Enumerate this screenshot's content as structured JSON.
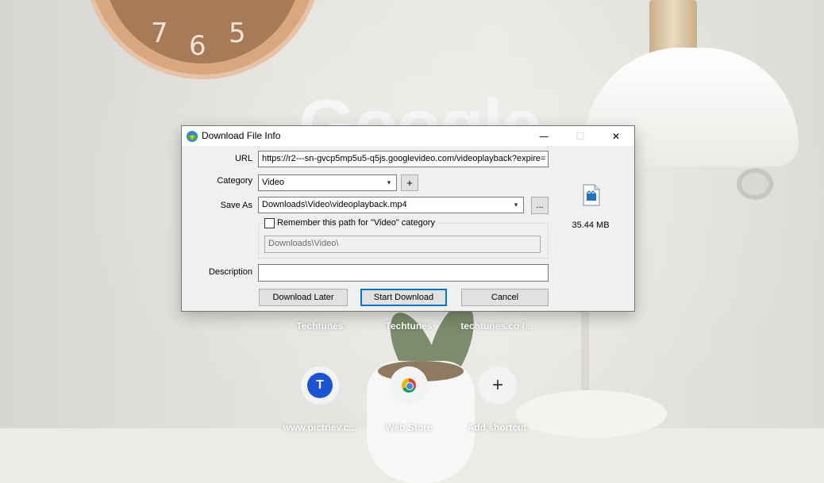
{
  "background": {
    "google_logo_text": "Google",
    "clock_numbers": [
      "7",
      "6",
      "5"
    ]
  },
  "shortcuts_row1": [
    {
      "label": "Techtunes"
    },
    {
      "label": "Techtunes"
    },
    {
      "label": "techtunes.co (..."
    }
  ],
  "shortcuts_row2": [
    {
      "label": "www.pictriev.c...",
      "avatar_letter": "T",
      "icon": "avatar-letter-icon"
    },
    {
      "label": "Web Store",
      "icon": "chrome-web-store-icon"
    },
    {
      "label": "Add shortcut",
      "icon": "plus-icon",
      "glyph": "+"
    }
  ],
  "dialog": {
    "title": "Download File Info",
    "controls": {
      "minimize": "—",
      "maximize": "☐",
      "close": "✕"
    },
    "url_label": "URL",
    "url_value": "https://r2---sn-gvcp5mp5u5-q5js.googlevideo.com/videoplayback?expire=",
    "category_label": "Category",
    "category_value": "Video",
    "add_category_button": "+",
    "save_as_label": "Save As",
    "save_as_value": "Downloads\\Video\\videoplayback.mp4",
    "browse_button": "...",
    "remember_label": "Remember this path for \"Video\" category",
    "remember_checked": false,
    "remember_path_value": "Downloads\\Video\\",
    "description_label": "Description",
    "description_value": "",
    "file_size": "35.44  MB",
    "file_icon": "video-file-icon",
    "buttons": {
      "download_later": "Download Later",
      "start_download": "Start Download",
      "cancel": "Cancel"
    }
  },
  "colors": {
    "dialog_bg": "#f0f0f0",
    "default_button_border": "#0078d7",
    "avatar_bg": "#1a53d4"
  }
}
